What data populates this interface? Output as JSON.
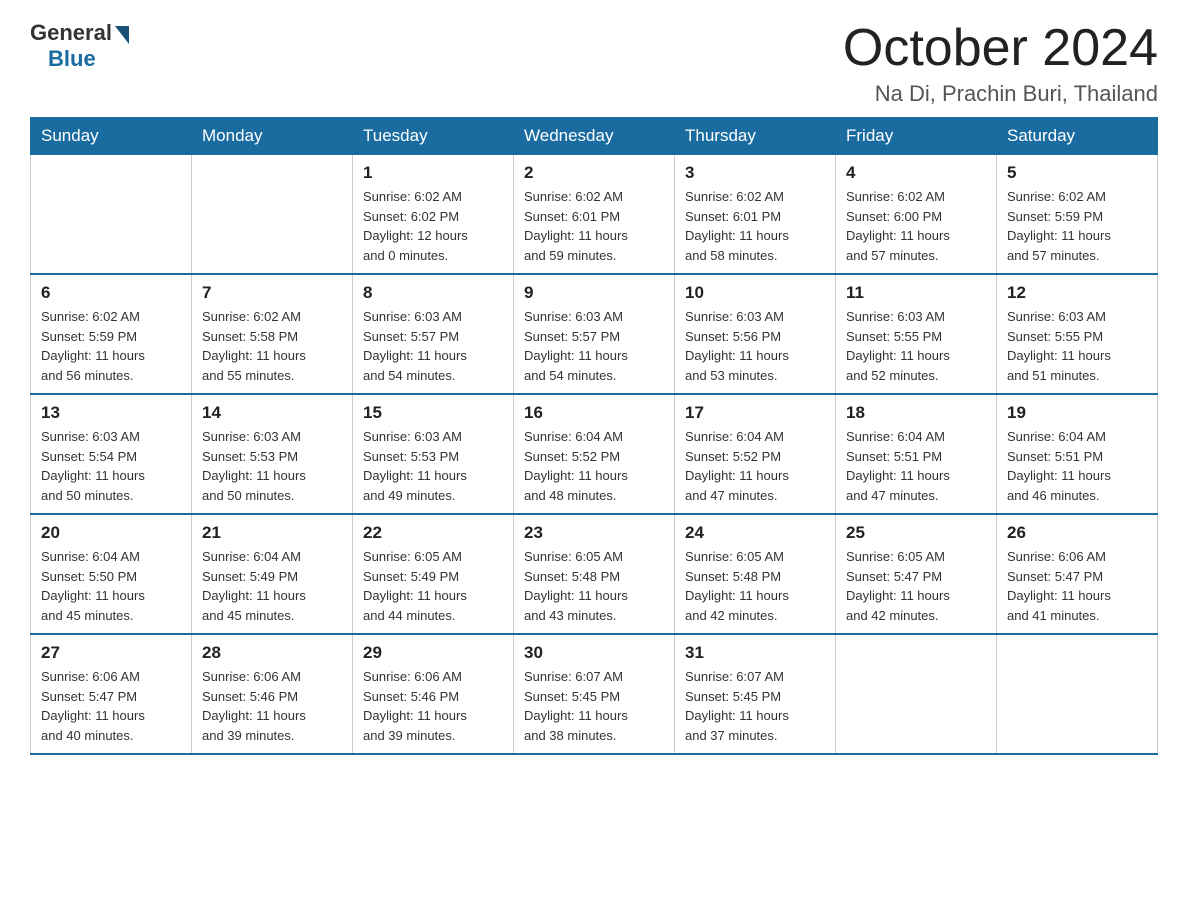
{
  "logo": {
    "general": "General",
    "blue": "Blue"
  },
  "header": {
    "month": "October 2024",
    "location": "Na Di, Prachin Buri, Thailand"
  },
  "days_of_week": [
    "Sunday",
    "Monday",
    "Tuesday",
    "Wednesday",
    "Thursday",
    "Friday",
    "Saturday"
  ],
  "weeks": [
    [
      {
        "day": "",
        "info": ""
      },
      {
        "day": "",
        "info": ""
      },
      {
        "day": "1",
        "info": "Sunrise: 6:02 AM\nSunset: 6:02 PM\nDaylight: 12 hours\nand 0 minutes."
      },
      {
        "day": "2",
        "info": "Sunrise: 6:02 AM\nSunset: 6:01 PM\nDaylight: 11 hours\nand 59 minutes."
      },
      {
        "day": "3",
        "info": "Sunrise: 6:02 AM\nSunset: 6:01 PM\nDaylight: 11 hours\nand 58 minutes."
      },
      {
        "day": "4",
        "info": "Sunrise: 6:02 AM\nSunset: 6:00 PM\nDaylight: 11 hours\nand 57 minutes."
      },
      {
        "day": "5",
        "info": "Sunrise: 6:02 AM\nSunset: 5:59 PM\nDaylight: 11 hours\nand 57 minutes."
      }
    ],
    [
      {
        "day": "6",
        "info": "Sunrise: 6:02 AM\nSunset: 5:59 PM\nDaylight: 11 hours\nand 56 minutes."
      },
      {
        "day": "7",
        "info": "Sunrise: 6:02 AM\nSunset: 5:58 PM\nDaylight: 11 hours\nand 55 minutes."
      },
      {
        "day": "8",
        "info": "Sunrise: 6:03 AM\nSunset: 5:57 PM\nDaylight: 11 hours\nand 54 minutes."
      },
      {
        "day": "9",
        "info": "Sunrise: 6:03 AM\nSunset: 5:57 PM\nDaylight: 11 hours\nand 54 minutes."
      },
      {
        "day": "10",
        "info": "Sunrise: 6:03 AM\nSunset: 5:56 PM\nDaylight: 11 hours\nand 53 minutes."
      },
      {
        "day": "11",
        "info": "Sunrise: 6:03 AM\nSunset: 5:55 PM\nDaylight: 11 hours\nand 52 minutes."
      },
      {
        "day": "12",
        "info": "Sunrise: 6:03 AM\nSunset: 5:55 PM\nDaylight: 11 hours\nand 51 minutes."
      }
    ],
    [
      {
        "day": "13",
        "info": "Sunrise: 6:03 AM\nSunset: 5:54 PM\nDaylight: 11 hours\nand 50 minutes."
      },
      {
        "day": "14",
        "info": "Sunrise: 6:03 AM\nSunset: 5:53 PM\nDaylight: 11 hours\nand 50 minutes."
      },
      {
        "day": "15",
        "info": "Sunrise: 6:03 AM\nSunset: 5:53 PM\nDaylight: 11 hours\nand 49 minutes."
      },
      {
        "day": "16",
        "info": "Sunrise: 6:04 AM\nSunset: 5:52 PM\nDaylight: 11 hours\nand 48 minutes."
      },
      {
        "day": "17",
        "info": "Sunrise: 6:04 AM\nSunset: 5:52 PM\nDaylight: 11 hours\nand 47 minutes."
      },
      {
        "day": "18",
        "info": "Sunrise: 6:04 AM\nSunset: 5:51 PM\nDaylight: 11 hours\nand 47 minutes."
      },
      {
        "day": "19",
        "info": "Sunrise: 6:04 AM\nSunset: 5:51 PM\nDaylight: 11 hours\nand 46 minutes."
      }
    ],
    [
      {
        "day": "20",
        "info": "Sunrise: 6:04 AM\nSunset: 5:50 PM\nDaylight: 11 hours\nand 45 minutes."
      },
      {
        "day": "21",
        "info": "Sunrise: 6:04 AM\nSunset: 5:49 PM\nDaylight: 11 hours\nand 45 minutes."
      },
      {
        "day": "22",
        "info": "Sunrise: 6:05 AM\nSunset: 5:49 PM\nDaylight: 11 hours\nand 44 minutes."
      },
      {
        "day": "23",
        "info": "Sunrise: 6:05 AM\nSunset: 5:48 PM\nDaylight: 11 hours\nand 43 minutes."
      },
      {
        "day": "24",
        "info": "Sunrise: 6:05 AM\nSunset: 5:48 PM\nDaylight: 11 hours\nand 42 minutes."
      },
      {
        "day": "25",
        "info": "Sunrise: 6:05 AM\nSunset: 5:47 PM\nDaylight: 11 hours\nand 42 minutes."
      },
      {
        "day": "26",
        "info": "Sunrise: 6:06 AM\nSunset: 5:47 PM\nDaylight: 11 hours\nand 41 minutes."
      }
    ],
    [
      {
        "day": "27",
        "info": "Sunrise: 6:06 AM\nSunset: 5:47 PM\nDaylight: 11 hours\nand 40 minutes."
      },
      {
        "day": "28",
        "info": "Sunrise: 6:06 AM\nSunset: 5:46 PM\nDaylight: 11 hours\nand 39 minutes."
      },
      {
        "day": "29",
        "info": "Sunrise: 6:06 AM\nSunset: 5:46 PM\nDaylight: 11 hours\nand 39 minutes."
      },
      {
        "day": "30",
        "info": "Sunrise: 6:07 AM\nSunset: 5:45 PM\nDaylight: 11 hours\nand 38 minutes."
      },
      {
        "day": "31",
        "info": "Sunrise: 6:07 AM\nSunset: 5:45 PM\nDaylight: 11 hours\nand 37 minutes."
      },
      {
        "day": "",
        "info": ""
      },
      {
        "day": "",
        "info": ""
      }
    ]
  ]
}
